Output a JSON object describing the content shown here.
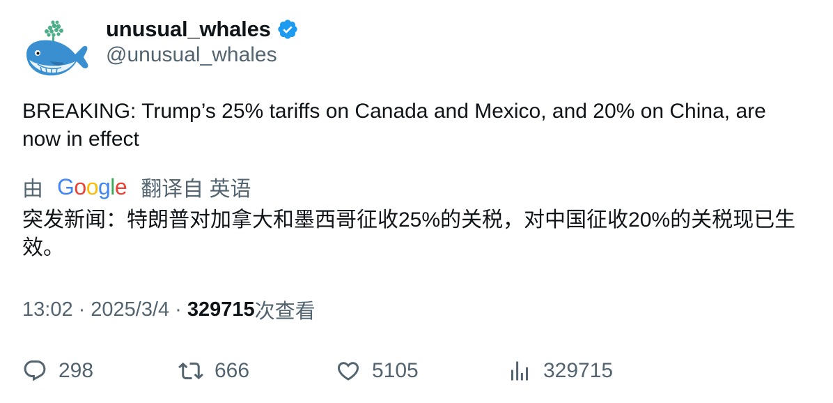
{
  "author": {
    "display_name": "unusual_whales",
    "handle": "@unusual_whales",
    "verified": true,
    "verified_color": "#1d9bf0"
  },
  "tweet": {
    "text": "BREAKING: Trump’s 25% tariffs on Canada and Mexico, and 20% on China, are now in effect"
  },
  "translation": {
    "prefix": "由",
    "provider": "Google",
    "suffix": "翻译自 英语",
    "text": "突发新闻：特朗普对加拿大和墨西哥征收25%的关税，对中国征收20%的关税现已生效。"
  },
  "meta": {
    "time": "13:02",
    "date": "2025/3/4",
    "views": "329715",
    "views_label": "次查看"
  },
  "actions": {
    "replies": "298",
    "retweets": "666",
    "likes": "5105",
    "views": "329715"
  },
  "icons": {
    "reply": "reply-icon",
    "retweet": "retweet-icon",
    "like": "heart-icon",
    "views": "analytics-icon"
  }
}
